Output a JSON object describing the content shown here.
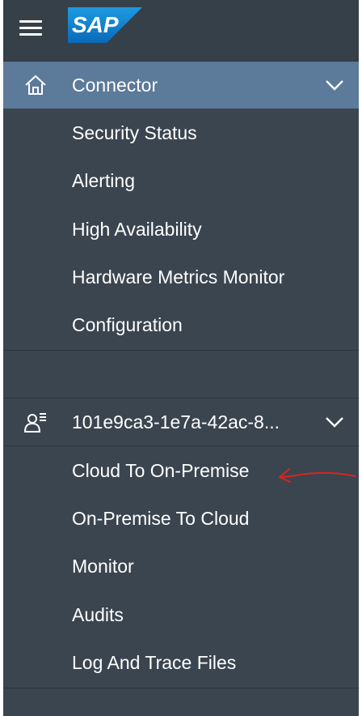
{
  "header": {
    "logo_text": "SAP",
    "icons": {
      "menu": "hamburger-menu-icon"
    }
  },
  "connector_group": {
    "label": "Connector",
    "icon": "home-icon",
    "expanded": true,
    "items": [
      {
        "label": "Security Status"
      },
      {
        "label": "Alerting"
      },
      {
        "label": "High Availability"
      },
      {
        "label": "Hardware Metrics Monitor"
      },
      {
        "label": "Configuration"
      }
    ]
  },
  "subaccount_group": {
    "label": "101e9ca3-1e7a-42ac-8...",
    "icon": "user-list-icon",
    "expanded": true,
    "items": [
      {
        "label": "Cloud To On-Premise"
      },
      {
        "label": "On-Premise To Cloud"
      },
      {
        "label": "Monitor"
      },
      {
        "label": "Audits"
      },
      {
        "label": "Log And Trace Files"
      }
    ]
  },
  "colors": {
    "sidebar_bg": "#3a4550",
    "selected_bg": "#5c7a99",
    "text": "#ffffff",
    "annotation": "#d9241e"
  }
}
